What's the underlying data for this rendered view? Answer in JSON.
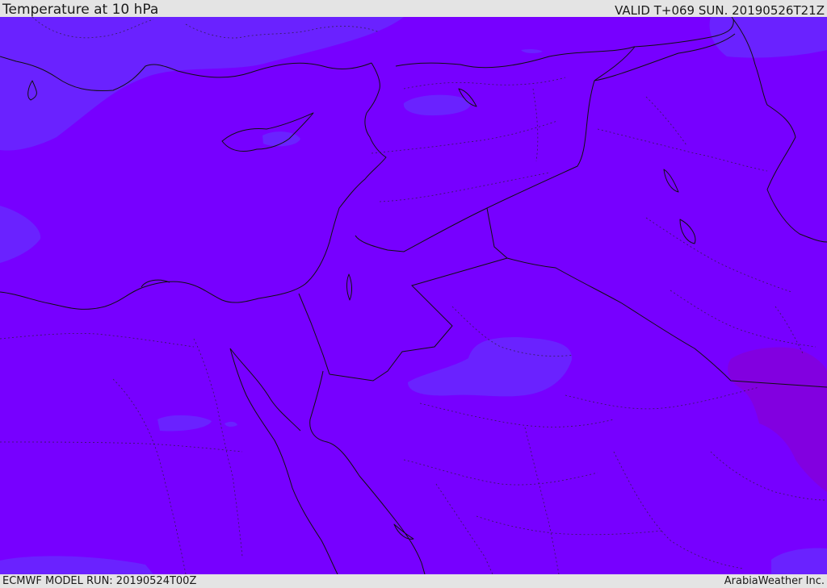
{
  "header": {
    "title": "Temperature at 10 hPa",
    "valid": "VALID T+069 SUN. 20190526T21Z"
  },
  "footer": {
    "model_run": "ECMWF MODEL RUN: 20190524T00Z",
    "credit": "ArabiaWeather Inc."
  },
  "colors": {
    "base_field": "#7700ff",
    "cooler_field": "#6a22ff",
    "warmer_field": "#8200e0",
    "lines": "#101010"
  }
}
